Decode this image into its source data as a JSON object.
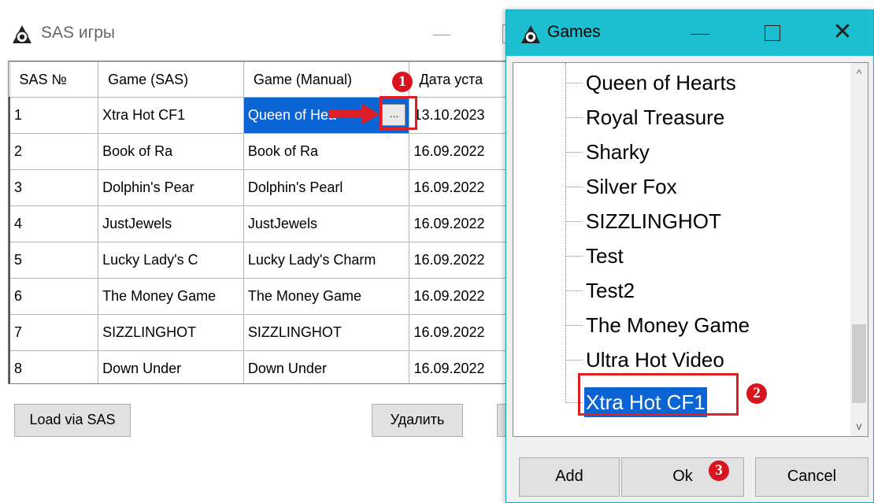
{
  "sas_window": {
    "title": "SAS игры",
    "columns": [
      "SAS №",
      "Game (SAS)",
      "Game (Manual)",
      "Дата уста"
    ],
    "rows": [
      {
        "num": "1",
        "game_sas": "Xtra Hot CF1",
        "game_manual": "Queen of Hea",
        "date": "13.10.2023"
      },
      {
        "num": "2",
        "game_sas": "Book of Ra",
        "game_manual": "Book of Ra",
        "date": "16.09.2022"
      },
      {
        "num": "3",
        "game_sas": "Dolphin's Pear",
        "game_manual": "Dolphin's Pearl",
        "date": "16.09.2022"
      },
      {
        "num": "4",
        "game_sas": "JustJewels",
        "game_manual": "JustJewels",
        "date": "16.09.2022"
      },
      {
        "num": "5",
        "game_sas": "Lucky Lady's C",
        "game_manual": "Lucky Lady's Charm",
        "date": "16.09.2022"
      },
      {
        "num": "6",
        "game_sas": "The Money Game",
        "game_manual": "The Money Game",
        "date": "16.09.2022"
      },
      {
        "num": "7",
        "game_sas": "SIZZLINGHOT",
        "game_manual": "SIZZLINGHOT",
        "date": "16.09.2022"
      },
      {
        "num": "8",
        "game_sas": "Down Under",
        "game_manual": "Down Under",
        "date": "16.09.2022"
      }
    ],
    "edit_button_label": "...",
    "load_button": "Load via SAS",
    "delete_button": "Удалить"
  },
  "games_dialog": {
    "title": "Games",
    "close_glyph": "✕",
    "items": [
      "Queen of Hearts",
      "Royal Treasure",
      "Sharky",
      "Silver Fox",
      "SIZZLINGHOT",
      "Test",
      "Test2",
      "The Money Game",
      "Ultra Hot Video",
      "Xtra Hot CF1"
    ],
    "selected_item": "Xtra Hot CF1",
    "add_button": "Add",
    "ok_button": "Ok",
    "cancel_button": "Cancel",
    "scroll_up_glyph": "^",
    "scroll_down_glyph": "v"
  },
  "annotations": {
    "markers": [
      "1",
      "2",
      "3"
    ],
    "color": "#d9141f"
  },
  "colors": {
    "dialog_titlebar": "#1bbfcf",
    "selection": "#0a64d4"
  },
  "icons": [
    "app-logo-icon",
    "minimize-icon",
    "maximize-icon",
    "close-icon",
    "chevron-up-icon",
    "chevron-down-icon",
    "arrow-right-icon"
  ]
}
